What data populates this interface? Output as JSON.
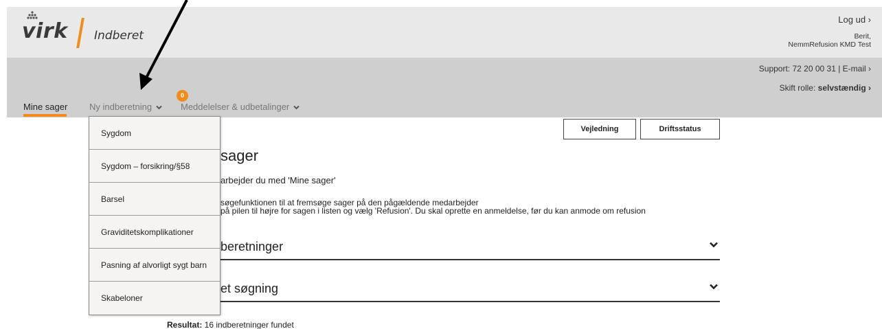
{
  "header": {
    "brand": "virk",
    "product": "Indberet",
    "logout": "Log ud ›",
    "user_line1": "Berit,",
    "user_line2": "NemmRefusion KMD Test",
    "support": "Support: 72 20 00 31 | E-mail ›",
    "role_label": "Skift rolle: ",
    "role_value": "selvstændig ›"
  },
  "nav": {
    "mine_sager": "Mine sager",
    "ny_indberetning": "Ny indberetning",
    "meddelelser": "Meddelelser & udbetalinger",
    "badge_count": "0",
    "chevron": "❯"
  },
  "dropdown": {
    "items": [
      "Sygdom",
      "Sygdom – forsikring/§58",
      "Barsel",
      "Graviditetskomplikationer",
      "Pasning af alvorligt sygt barn",
      "Skabeloner"
    ]
  },
  "main": {
    "btn_vejledning": "Vejledning",
    "btn_driftsstatus": "Driftsstatus",
    "title": "sager",
    "subtitle": "arbejder du med 'Mine sager'",
    "line1": "søgefunktionen til at fremsøge sager på den pågældende medarbejder",
    "line2": "på pilen til højre for sagen i listen og vælg 'Refusion'. Du skal oprette en anmeldelse, før du kan anmode om refusion",
    "section1": "beretninger",
    "section2": "et søgning",
    "result_label": "Resultat:",
    "result_value": " 16 indberetninger fundet"
  },
  "colors": {
    "accent": "#f08b1d",
    "header_bg": "#e9e9e9",
    "subheader_bg": "#cfcfcf"
  },
  "icons": {
    "chevron_down": "chevron-down-icon",
    "arrow": "annotation-arrow"
  }
}
